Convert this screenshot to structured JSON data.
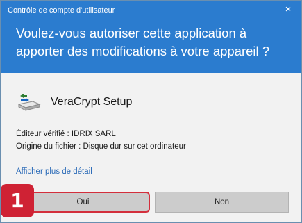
{
  "window": {
    "title": "Contrôle de compte d'utilisateur",
    "close_glyph": "×"
  },
  "prompt": {
    "question": "Voulez-vous autoriser cette application à apporter des modifications à votre appareil ?"
  },
  "app": {
    "name": "VeraCrypt Setup",
    "icon": "veracrypt-drive-icon"
  },
  "details": {
    "publisher": "Éditeur vérifié : IDRIX SARL",
    "origin": "Origine du fichier : Disque dur sur cet ordinateur",
    "more_link": "Afficher plus de détail"
  },
  "buttons": {
    "yes_label": "Oui",
    "no_label": "Non"
  },
  "annotation": {
    "step_number": "1"
  },
  "colors": {
    "header_bg": "#2b7ccf",
    "highlight": "#d32f3c",
    "link": "#2b6bb8"
  }
}
